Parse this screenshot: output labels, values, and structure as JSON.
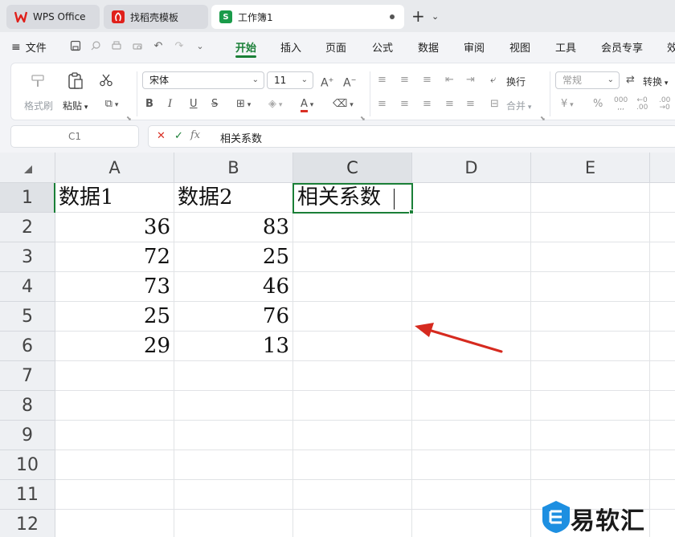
{
  "tabs": [
    {
      "label": "WPS Office"
    },
    {
      "label": "找稻壳模板"
    },
    {
      "label": "工作簿1"
    }
  ],
  "menu": {
    "file": "文件",
    "items": [
      "开始",
      "插入",
      "页面",
      "公式",
      "数据",
      "审阅",
      "视图",
      "工具",
      "会员专享",
      "效"
    ]
  },
  "ribbon": {
    "format_painter": "格式刷",
    "paste": "粘贴",
    "font_name": "宋体",
    "font_size": "11",
    "wrap": "换行",
    "merge": "合并",
    "number_format": "常规",
    "convert": "转换"
  },
  "formula_bar": {
    "name_box": "C1",
    "fx": "fx",
    "content": "相关系数"
  },
  "grid": {
    "columns": [
      "A",
      "B",
      "C",
      "D",
      "E"
    ],
    "rows": [
      "1",
      "2",
      "3",
      "4",
      "5",
      "6",
      "7",
      "8",
      "9",
      "10",
      "11",
      "12"
    ],
    "header_row": [
      "数据1",
      "数据2",
      "相关系数"
    ],
    "data1": [
      "36",
      "72",
      "73",
      "25",
      "29"
    ],
    "data2": [
      "83",
      "25",
      "46",
      "76",
      "13"
    ]
  },
  "watermark": {
    "text": "易软汇"
  },
  "colors": {
    "accent": "#1a7f37",
    "arrow": "#d62a1f"
  }
}
